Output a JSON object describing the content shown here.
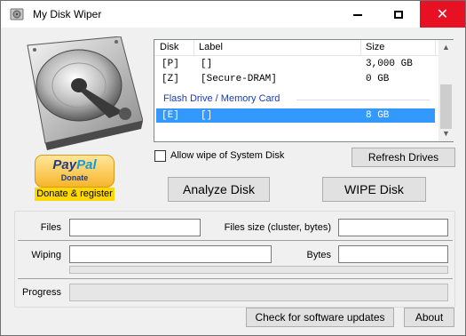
{
  "window": {
    "title": "My Disk Wiper",
    "controls": {
      "minimize": "minimize-icon",
      "maximize": "maximize-icon",
      "close": "close-icon"
    },
    "accent_close": "#e81123"
  },
  "donate": {
    "paypal_brand_1": "Pay",
    "paypal_brand_2": "Pal",
    "paypal_sub": "Donate",
    "label": "Donate & register"
  },
  "drive_list": {
    "columns": [
      "Disk",
      "Label",
      "Size"
    ],
    "rows": [
      {
        "disk": "[P]",
        "label": "[]",
        "size": "3,000 GB"
      },
      {
        "disk": "[Z]",
        "label": "[Secure-DRAM]",
        "size": "0 GB"
      }
    ],
    "group_title": "Flash Drive / Memory Card",
    "group_rows": [
      {
        "disk": "[E]",
        "label": "[]",
        "size": "8 GB",
        "selected": true
      }
    ],
    "selection_color": "#3399ff",
    "group_color": "#1e3ca8"
  },
  "options": {
    "allow_system_wipe_label": "Allow wipe of System Disk",
    "allow_system_wipe_checked": false
  },
  "buttons": {
    "refresh": "Refresh Drives",
    "analyze": "Analyze Disk",
    "wipe": "WIPE Disk",
    "updates": "Check for software updates",
    "about": "About"
  },
  "stats": {
    "files_label": "Files",
    "files_value": "",
    "files_size_label": "Files size (cluster, bytes)",
    "files_size_value": "",
    "wiping_label": "Wiping",
    "wiping_value": "",
    "bytes_label": "Bytes",
    "bytes_value": "",
    "progress_label": "Progress"
  }
}
